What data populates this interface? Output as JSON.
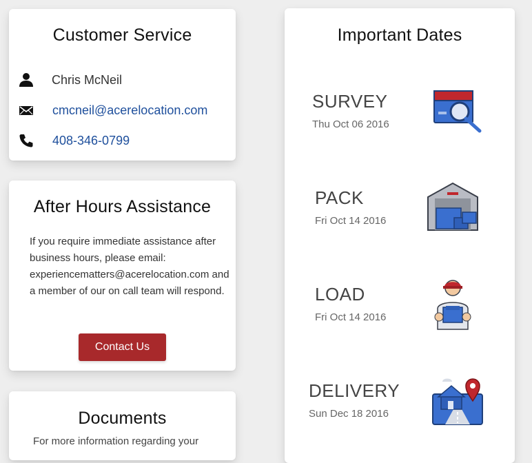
{
  "customer_service": {
    "title": "Customer Service",
    "name": "Chris McNeil",
    "email": "cmcneil@acerelocation.com",
    "phone": "408-346-0799",
    "icons": [
      "person-icon",
      "envelope-icon",
      "phone-icon"
    ]
  },
  "after_hours": {
    "title": "After Hours Assistance",
    "text": "If you require immediate assistance after business hours, please email: experiencematters@acerelocation.com and a member of our on call team will respond.",
    "button_label": "Contact Us",
    "button_color": "#a8292b"
  },
  "documents": {
    "title": "Documents",
    "text": "For more information regarding your"
  },
  "important_dates": {
    "title": "Important Dates",
    "items": [
      {
        "label": "SURVEY",
        "date": "Thu Oct 06 2016",
        "icon": "survey-icon"
      },
      {
        "label": "PACK",
        "date": "Fri Oct 14 2016",
        "icon": "warehouse-icon"
      },
      {
        "label": "LOAD",
        "date": "Fri Oct 14 2016",
        "icon": "mover-icon"
      },
      {
        "label": "DELIVERY",
        "date": "Sun Dec 18 2016",
        "icon": "delivery-map-icon"
      }
    ]
  },
  "colors": {
    "link": "#1e4f9c",
    "accent_red": "#a8292b",
    "icon_blue": "#3a6fcf"
  }
}
